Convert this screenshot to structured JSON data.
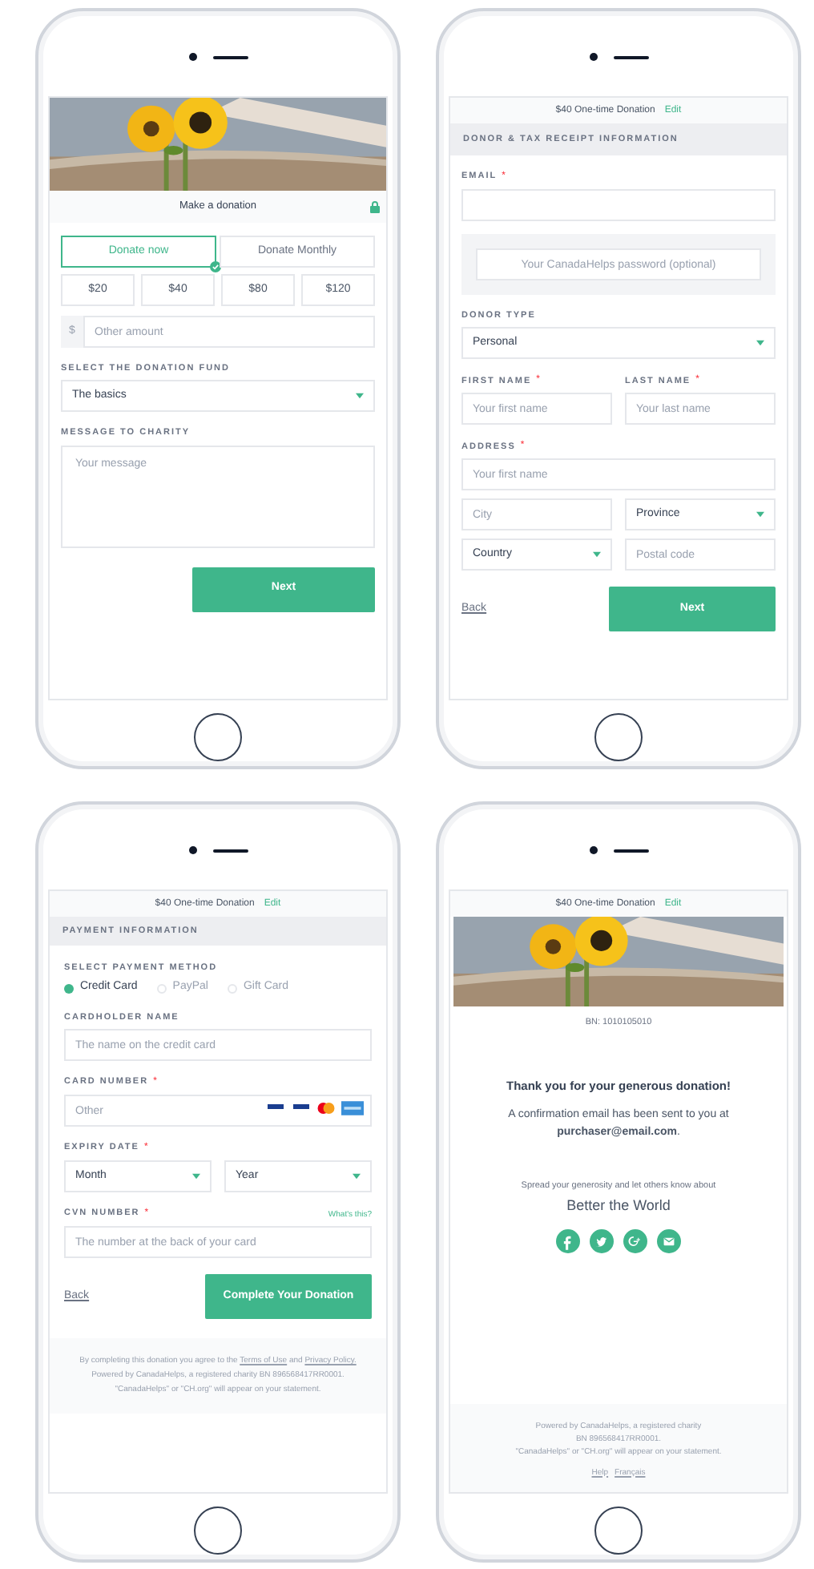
{
  "screens": [
    {
      "kind": "amount",
      "title": "Make a donation",
      "tabs": [
        {
          "label": "Donate now",
          "selected": true
        },
        {
          "label": "Donate Monthly",
          "selected": false
        }
      ],
      "amounts": [
        "$20",
        "$40",
        "$80",
        "$120"
      ],
      "other": {
        "prefix": "$",
        "placeholder": "Other amount"
      },
      "fund": {
        "label": "SELECT THE DONATION FUND",
        "value": "The basics"
      },
      "message": {
        "label": "MESSAGE TO CHARITY",
        "placeholder": "Your message"
      },
      "next": "Next"
    },
    {
      "kind": "donor",
      "summary": "$40 One-time Donation",
      "edit": "Edit",
      "section": "DONOR & TAX RECEIPT INFORMATION",
      "email": {
        "label": "EMAIL",
        "required": "*"
      },
      "password": {
        "placeholder": "Your CanadaHelps password (optional)"
      },
      "donor_type": {
        "label": "DONOR TYPE",
        "value": "Personal"
      },
      "first_name": {
        "label": "FIRST NAME",
        "required": "*",
        "placeholder": "Your first name"
      },
      "last_name": {
        "label": "LAST NAME",
        "required": "*",
        "placeholder": "Your last name"
      },
      "address": {
        "label": "ADDRESS",
        "required": "*",
        "placeholder": "Your first name",
        "city_placeholder": "City",
        "province": "Province",
        "country": "Country",
        "postal_placeholder": "Postal code"
      },
      "back": "Back",
      "next": "Next"
    },
    {
      "kind": "payment",
      "summary": "$40 One-time Donation",
      "edit": "Edit",
      "section": "PAYMENT INFORMATION",
      "method_label": "SELECT PAYMENT METHOD",
      "methods": [
        {
          "label": "Credit Card",
          "selected": true
        },
        {
          "label": "PayPal",
          "selected": false
        },
        {
          "label": "Gift Card",
          "selected": false
        }
      ],
      "cardholder": {
        "label": "CARDHOLDER NAME",
        "placeholder": "The name on the credit card"
      },
      "card_number": {
        "label": "CARD NUMBER",
        "required": "*",
        "placeholder": "Other"
      },
      "expiry": {
        "label": "EXPIRY DATE",
        "required": "*",
        "month": "Month",
        "year": "Year"
      },
      "cvn": {
        "label": "CVN NUMBER",
        "required": "*",
        "help": "What's this?",
        "placeholder": "The number at the back of your card"
      },
      "back": "Back",
      "submit": "Complete Your Donation",
      "footer": {
        "before": "By completing this donation you agree to the",
        "terms": "Terms of Use",
        "and": "and",
        "privacy": "Privacy Policy.",
        "after": "Powered by CanadaHelps, a registered charity BN 896568417RR0001.",
        "statement": "\"CanadaHelps\" or \"CH.org\" will appear on your statement."
      }
    },
    {
      "kind": "thanks",
      "summary": "$40 One-time Donation",
      "edit": "Edit",
      "bn": "BN: 1010105010",
      "thanks": "Thank you for your generous donation!",
      "confirmation": "A confirmation email has been sent to you at **purchaser@email.com**.",
      "spread": "Spread your generosity and let others know about",
      "charity": "Better the World",
      "footer": {
        "lines": [
          "Powered by CanadaHelps, a registered charity",
          "BN 896568417RR0001.",
          "\"CanadaHelps\" or \"CH.org\" will appear on your statement."
        ],
        "links": [
          "Help",
          "Français"
        ]
      }
    }
  ]
}
